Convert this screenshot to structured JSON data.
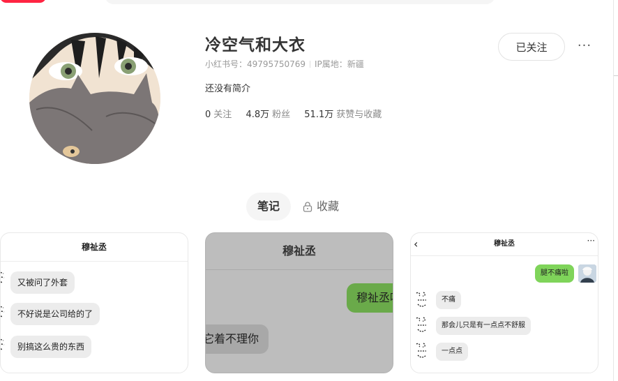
{
  "profile": {
    "name": "冷空气和大衣",
    "id_label": "小红书号：",
    "id_value": "49795750769",
    "ip_label": "IP属地：",
    "ip_value": "新疆",
    "bio": "还没有简介",
    "follow_button": "已关注",
    "more_button": "···"
  },
  "stats": [
    {
      "value": "0",
      "label": "关注"
    },
    {
      "value": "4.8万",
      "label": "粉丝"
    },
    {
      "value": "51.1万",
      "label": "获赞与收藏"
    }
  ],
  "tabs": [
    {
      "label": "笔记",
      "active": true
    },
    {
      "label": "收藏",
      "active": false,
      "icon": "lock-icon"
    }
  ],
  "cards": [
    {
      "title": "穆祉丞",
      "messages": [
        "又被问了外套",
        "不好说是公司给的了",
        "别搞这么贵的东西"
      ]
    },
    {
      "title": "穆祉丞",
      "messages": [
        "穆祉丞呢",
        "它着不理你"
      ]
    },
    {
      "title": "穆祉丞",
      "outgoing": "腿不痛啦",
      "messages": [
        "不痛",
        "那会儿只是有一点点不舒服",
        "一点点"
      ]
    }
  ],
  "colors": {
    "brand": "#ff2442",
    "chat_green": "#7fd45a"
  }
}
